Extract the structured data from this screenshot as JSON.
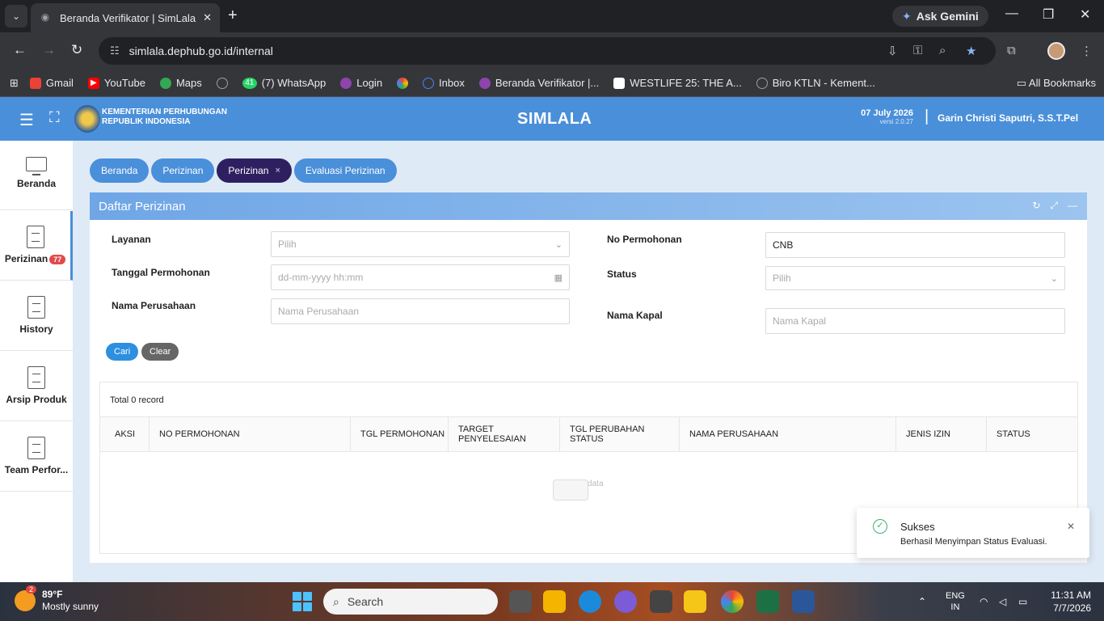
{
  "browser": {
    "tab_title": "Beranda Verifikator | SimLala",
    "url": "simlala.dephub.go.id/internal",
    "gemini_label": "Ask Gemini",
    "bookmarks": [
      {
        "label": "Gmail",
        "color": "#ea4335"
      },
      {
        "label": "YouTube",
        "color": "#ff0000"
      },
      {
        "label": "Maps",
        "color": "#34a853"
      },
      {
        "label": "",
        "color": "#9aa0a6"
      },
      {
        "label": "(7) WhatsApp",
        "color": "#25d366",
        "badge": "41"
      },
      {
        "label": "Login",
        "color": "#8e44ad"
      },
      {
        "label": "",
        "color": "#fbbc05"
      },
      {
        "label": "Inbox",
        "color": "#4285f4"
      },
      {
        "label": "Beranda Verifikator |...",
        "color": "#8e44ad"
      },
      {
        "label": "WESTLIFE 25: THE A...",
        "color": "#ffffff"
      },
      {
        "label": "Biro KTLN - Kement...",
        "color": "#9aa0a6"
      }
    ],
    "all_bookmarks": "All Bookmarks"
  },
  "header": {
    "org_line1": "KEMENTERIAN PERHUBUNGAN",
    "org_line2": "REPUBLIK INDONESIA",
    "app_name": "SIMLALA",
    "date": "07 July 2026",
    "version": "versi 2.0.27",
    "user": "Garin Christi Saputri, S.S.T.Pel",
    "accent": "#4a8fd9"
  },
  "sidebar": {
    "items": [
      {
        "label": "Beranda",
        "icon": "monitor-icon"
      },
      {
        "label": "Perizinan",
        "icon": "document-icon",
        "badge": "77"
      },
      {
        "label": "History",
        "icon": "document-icon"
      },
      {
        "label": "Arsip Produk",
        "icon": "document-icon"
      },
      {
        "label": "Team Perfor...",
        "icon": "document-icon"
      }
    ]
  },
  "crumbs": [
    {
      "label": "Beranda"
    },
    {
      "label": "Perizinan"
    },
    {
      "label": "Perizinan",
      "active": true,
      "close": "×"
    },
    {
      "label": "Evaluasi Perizinan"
    }
  ],
  "panel": {
    "title": "Daftar Perizinan",
    "form": {
      "layanan_label": "Layanan",
      "layanan_placeholder": "Pilih",
      "tanggal_label": "Tanggal Permohonan",
      "tanggal_placeholder": "dd-mm-yyyy hh:mm",
      "nama_perusahaan_label": "Nama Perusahaan",
      "nama_perusahaan_placeholder": "Nama Perusahaan",
      "no_permohonan_label": "No Permohonan",
      "no_permohonan_value": "CNB",
      "status_label": "Status",
      "status_placeholder": "Pilih",
      "nama_kapal_label": "Nama Kapal",
      "nama_kapal_placeholder": "Nama Kapal"
    },
    "buttons": {
      "cari": "Cari",
      "clear": "Clear"
    },
    "table": {
      "total": "Total 0 record",
      "columns": [
        "AKSI",
        "NO PERMOHONAN",
        "TGL PERMOHONAN",
        "TARGET PENYELESAIAN",
        "TGL PERUBAHAN STATUS",
        "NAMA PERUSAHAAN",
        "JENIS IZIN",
        "STATUS"
      ],
      "empty_text": "No data"
    }
  },
  "toast": {
    "title": "Sukses",
    "message": "Berhasil Menyimpan Status Evaluasi."
  },
  "taskbar": {
    "weather_temp": "89°F",
    "weather_desc": "Mostly sunny",
    "weather_badge": "2",
    "search_label": "Search",
    "lang1": "ENG",
    "lang2": "IN",
    "time": "11:31 AM",
    "date": "7/7/2026"
  }
}
